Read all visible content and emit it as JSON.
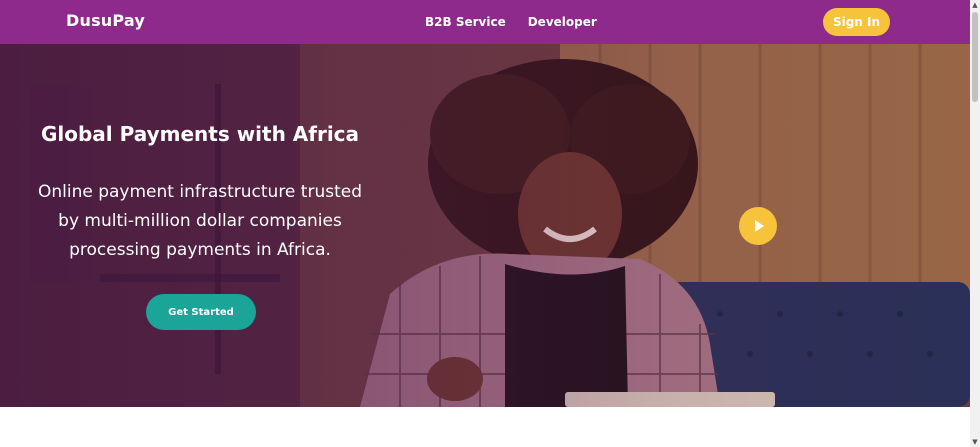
{
  "navbar": {
    "brand": "DusuPay",
    "links": [
      {
        "label": "B2B Service"
      },
      {
        "label": "Developer"
      }
    ],
    "signin_label": "Sign In"
  },
  "hero": {
    "title": "Global Payments with Africa",
    "subtitle": "Online payment infrastructure trusted by multi-million dollar companies processing payments in Africa.",
    "cta_label": "Get Started",
    "play_icon": "play-icon"
  },
  "colors": {
    "nav_bg": "#8e2a8c",
    "accent_yellow": "#f7c33b",
    "cta_teal": "#1aa598"
  }
}
